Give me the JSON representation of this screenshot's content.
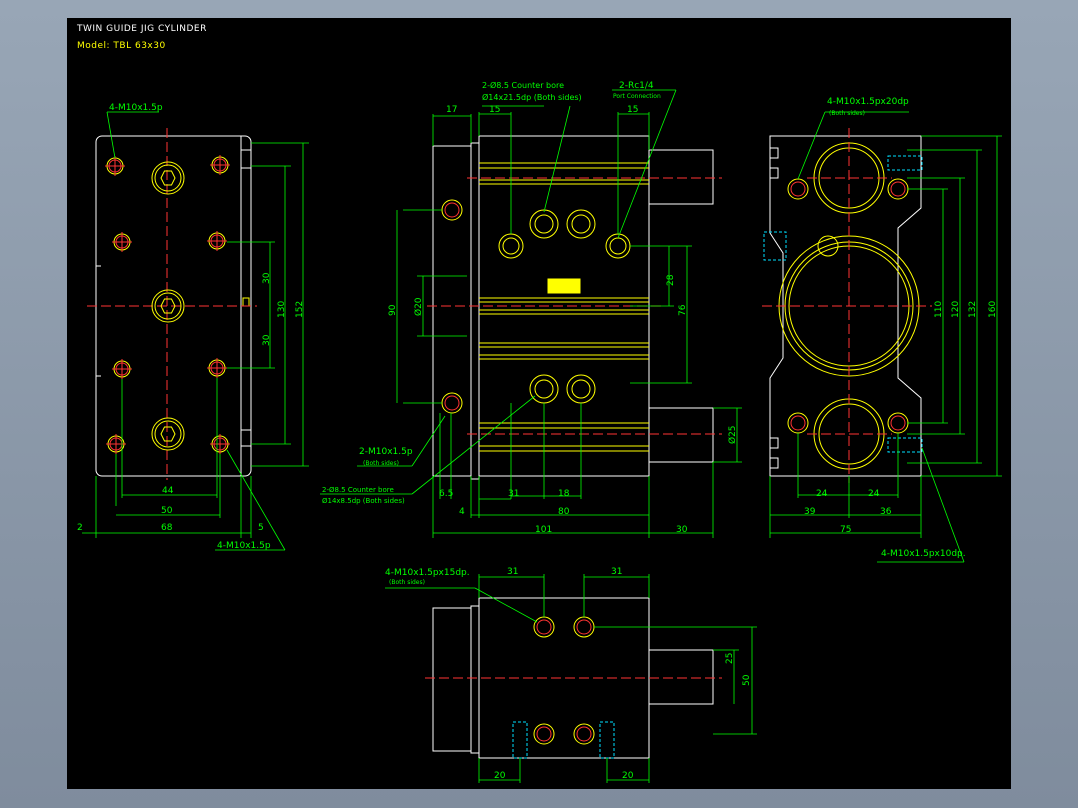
{
  "header": {
    "title": "TWIN GUIDE JIG CYLINDER",
    "model": "Model: TBL 63x30"
  },
  "labels": {
    "m10_front": "4-M10x1.5p",
    "counter_bore_top_a": "2-Ø8.5 Counter bore",
    "counter_bore_top_b": "Ø14x21.5dp (Both sides)",
    "rc": "2-Rc1/4",
    "port_connection": "Port Connection",
    "m10_side": "2-M10x1.5p",
    "both_sides": "(Both sides)",
    "counter_bore_bottom_a": "2-Ø8.5 Counter bore",
    "counter_bore_bottom_b": "Ø14x8.5dp (Both sides)",
    "m10_rear_top": "4-M10x1.5px20dp",
    "m10_rear_bottom": "4-M10x1.5px10dp.",
    "m10_top_view": "4-M10x1.5px15dp."
  },
  "dims": {
    "d152": "152",
    "d130": "130",
    "d30": "30",
    "d44": "44",
    "d50": "50",
    "d68": "68",
    "d2": "2",
    "d5": "5",
    "d17": "17",
    "d15": "15",
    "d90": "90",
    "dphi20": "Ø20",
    "d28": "28",
    "d76": "76",
    "dphi25": "Ø25",
    "d6_5": "6.5",
    "d31": "31",
    "d18": "18",
    "d4": "4",
    "d80": "80",
    "d101": "101",
    "d160": "160",
    "d132": "132",
    "d120": "120",
    "d110": "110",
    "d24": "24",
    "d39": "39",
    "d36": "36",
    "d75": "75",
    "d25": "25",
    "d20": "20"
  },
  "colors": {
    "background": "#000000",
    "outline": "#ffffff",
    "feature": "#ffff00",
    "centerline": "#ff3333",
    "dimension": "#00ff00",
    "hidden": "#00e0ff"
  }
}
